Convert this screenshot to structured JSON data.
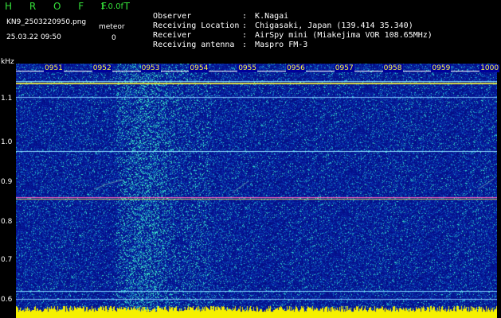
{
  "app": {
    "logo": "H R O F F T",
    "version": "1.0.0f",
    "filename": "KN9_2503220950.png",
    "datetime": "25.03.22 09:50",
    "meteor_label": "meteor",
    "meteor_count": "0"
  },
  "info": [
    {
      "label": "Observer",
      "value": "K.Nagai"
    },
    {
      "label": "Receiving Location",
      "value": "Chigasaki, Japan (139.414 35.340)"
    },
    {
      "label": "Receiver",
      "value": "AirSpy mini (Miakejima VOR 108.65MHz)"
    },
    {
      "label": "Receiving antenna",
      "value": "Maspro FM-3"
    }
  ],
  "axis": {
    "unit": "kHz",
    "y_ticks": [
      "1.1",
      "1.0",
      "0.9",
      "0.8",
      "0.7",
      "0.6"
    ],
    "time_labels": [
      "0951",
      "0952",
      "0953",
      "0954",
      "0955",
      "0956",
      "0957",
      "0958",
      "0959",
      "1000"
    ]
  },
  "colors": {
    "background_noise": "#0a1aa8",
    "label_text": "#ffff40",
    "logo": "#35e23a",
    "baseline": "#ffff00"
  }
}
